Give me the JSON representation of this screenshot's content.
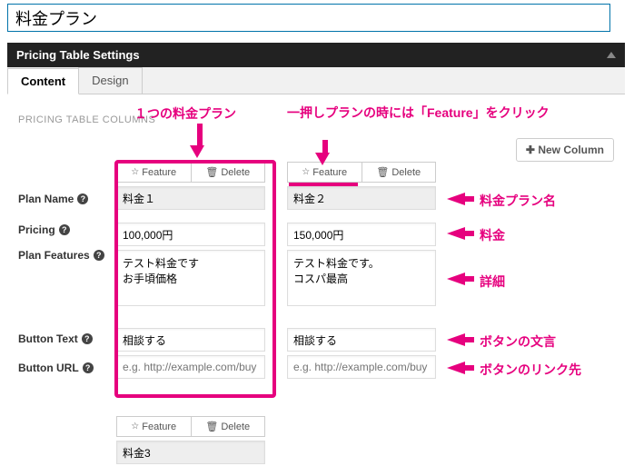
{
  "page_title": "料金プラン",
  "panel_title": "Pricing Table Settings",
  "tabs": {
    "content": "Content",
    "design": "Design"
  },
  "columns_title": "PRICING TABLE COLUMNS",
  "new_column": "New Column",
  "row_labels": {
    "plan_name": "Plan Name",
    "pricing": "Pricing",
    "plan_features": "Plan Features",
    "button_text": "Button Text",
    "button_url": "Button URL"
  },
  "btn": {
    "feature": "Feature",
    "delete": "Delete"
  },
  "url_placeholder": "e.g. http://example.com/buy",
  "col1": {
    "name": "料金１",
    "price": "100,000円",
    "features": "テスト料金です\nお手頃価格",
    "btn_text": "相談する",
    "btn_url": ""
  },
  "col2": {
    "name": "料金２",
    "price": "150,000円",
    "features": "テスト料金です。\nコスパ最高",
    "btn_text": "相談する",
    "btn_url": ""
  },
  "col3": {
    "name": "料金3"
  },
  "anno": {
    "one_plan": "１つの料金プラン",
    "feature_hint": "一押しプランの時には「Feature」をクリック",
    "plan_name": "料金プラン名",
    "price": "料金",
    "detail": "詳細",
    "btn_text": "ボタンの文言",
    "btn_url": "ボタンのリンク先"
  }
}
